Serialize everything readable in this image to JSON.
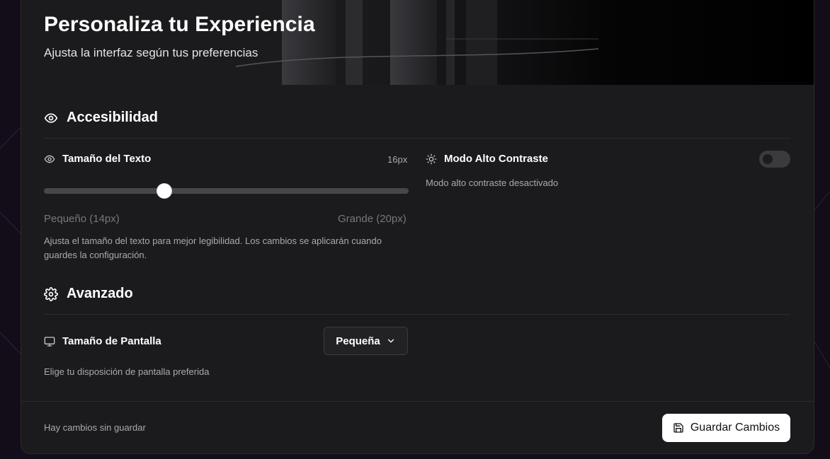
{
  "hero": {
    "title": "Personaliza tu Experiencia",
    "subtitle": "Ajusta la interfaz según tus preferencias"
  },
  "accessibility": {
    "title": "Accesibilidad",
    "icon": "eye-icon",
    "text_size": {
      "label": "Tamaño del Texto",
      "value": "16px",
      "min_label": "Pequeño (14px)",
      "max_label": "Grande (20px)",
      "level": 0.33,
      "help": "Ajusta el tamaño del texto para mejor legibilidad. Los cambios se aplicarán cuando guardes la configuración."
    },
    "high_contrast": {
      "label": "Modo Alto Contraste",
      "status": "Modo alto contraste desactivado",
      "enabled": false
    }
  },
  "advanced": {
    "title": "Avanzado",
    "icon": "gear-icon",
    "screen_size": {
      "label": "Tamaño de Pantalla",
      "selected": "Pequeña",
      "help": "Elige tu disposición de pantalla preferida"
    }
  },
  "footer": {
    "status": "Hay cambios sin guardar",
    "save_label": "Guardar Cambios"
  },
  "colors": {
    "card": "#1b1b1e",
    "accent": "#ffffff",
    "track": "#46464b"
  }
}
